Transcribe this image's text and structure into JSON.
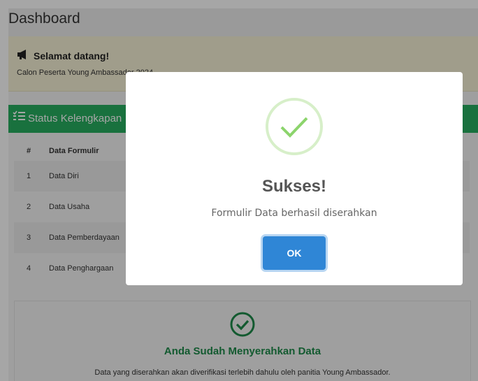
{
  "page": {
    "title": "Dashboard"
  },
  "welcome": {
    "title": "Selamat datang!",
    "subtitle": "Calon Peserta Young Ambassador 2024"
  },
  "status_panel": {
    "title": "Status Kelengkapan",
    "columns": [
      "#",
      "Data Formulir"
    ],
    "rows": [
      {
        "num": "1",
        "name": "Data Diri"
      },
      {
        "num": "2",
        "name": "Data Usaha"
      },
      {
        "num": "3",
        "name": "Data Pemberdayaan"
      },
      {
        "num": "4",
        "name": "Data Penghargaan"
      }
    ]
  },
  "submitted": {
    "title": "Anda Sudah Menyerahkan Data",
    "note": "Data yang diserahkan akan diverifikasi terlebih dahulu oleh panitia Young Ambassador."
  },
  "modal": {
    "title": "Sukses!",
    "message": "Formulir Data berhasil diserahkan",
    "ok_label": "OK"
  },
  "colors": {
    "green": "#27ae60",
    "dark_green": "#1e8b4a",
    "blue": "#2f86d6",
    "yellow": "#f6f1d6"
  }
}
